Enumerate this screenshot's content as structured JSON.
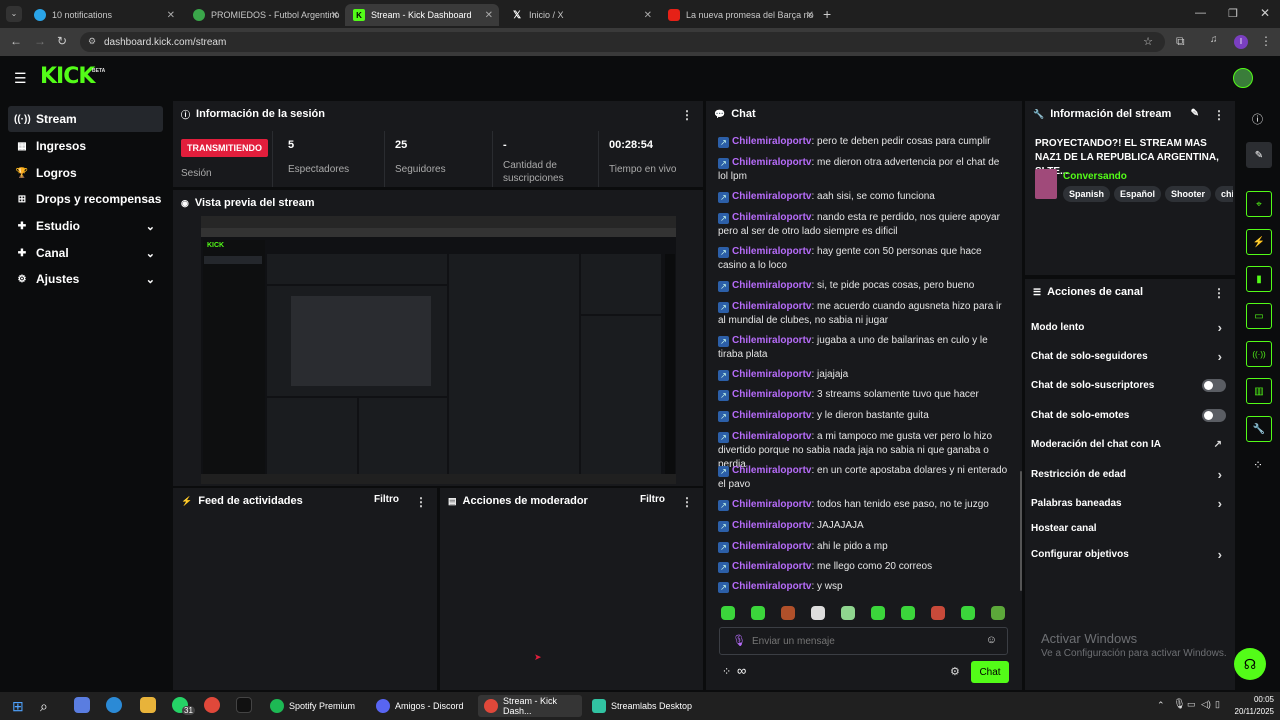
{
  "browser": {
    "tabs": [
      {
        "label": "10 notifications",
        "color": "#2aa4e8"
      },
      {
        "label": "PROMIEDOS - Futbol Argentino",
        "color": "#3aa64a"
      },
      {
        "label": "Stream - Kick Dashboard",
        "color": "#53fc18"
      },
      {
        "label": "Inicio / X",
        "color": "#000000"
      },
      {
        "label": "La nueva promesa del Barça no",
        "color": "#e62117"
      }
    ],
    "url": "dashboard.kick.com/stream",
    "profile_letter": "I"
  },
  "header": {
    "logo": "KICK",
    "beta": "BETA"
  },
  "sidebar": {
    "items": [
      {
        "label": "Stream",
        "icon": "broadcast-icon",
        "glyph": "((·))"
      },
      {
        "label": "Ingresos",
        "icon": "money-icon",
        "glyph": "▦"
      },
      {
        "label": "Logros",
        "icon": "trophy-icon",
        "glyph": "🏆"
      },
      {
        "label": "Drops y recompensas",
        "icon": "gift-icon",
        "glyph": "⊞"
      },
      {
        "label": "Estudio",
        "icon": "studio-icon",
        "glyph": "✚"
      },
      {
        "label": "Canal",
        "icon": "channel-icon",
        "glyph": "✚"
      },
      {
        "label": "Ajustes",
        "icon": "gear-icon",
        "glyph": "⚙"
      }
    ]
  },
  "session": {
    "title": "Información de la sesión",
    "badge": "TRANSMITIENDO",
    "badge_label": "Sesión",
    "stats": [
      {
        "value": "5",
        "label": "Espectadores"
      },
      {
        "value": "25",
        "label": "Seguidores"
      },
      {
        "value": "-",
        "label": "Cantidad de suscripciones"
      },
      {
        "value": "00:28:54",
        "label": "Tiempo en vivo"
      }
    ]
  },
  "preview": {
    "title": "Vista previa del stream"
  },
  "feed": {
    "title": "Feed de actividades",
    "filter": "Filtro"
  },
  "mod": {
    "title": "Acciones de moderador",
    "filter": "Filtro"
  },
  "chat": {
    "title": "Chat",
    "messages": [
      {
        "user": "Chilemiraloportv",
        "text": "pero te deben pedir cosas para cumplir"
      },
      {
        "user": "Chilemiraloportv",
        "text": "me dieron otra advertencia por el chat de lol lpm"
      },
      {
        "user": "Chilemiraloportv",
        "text": "aah sisi, se como funciona"
      },
      {
        "user": "Chilemiraloportv",
        "text": "nando esta re perdido, nos quiere apoyar pero al ser de otro lado siempre es dificil"
      },
      {
        "user": "Chilemiraloportv",
        "text": "hay gente con 50 personas que hace casino a lo loco"
      },
      {
        "user": "Chilemiraloportv",
        "text": "si, te pide pocas cosas, pero bueno"
      },
      {
        "user": "Chilemiraloportv",
        "text": "me acuerdo cuando agusneta hizo para ir al mundial de clubes, no sabia ni jugar"
      },
      {
        "user": "Chilemiraloportv",
        "text": "jugaba a uno de bailarinas en culo y le tiraba plata"
      },
      {
        "user": "Chilemiraloportv",
        "text": "jajajaja"
      },
      {
        "user": "Chilemiraloportv",
        "text": "3 streams solamente tuvo que hacer"
      },
      {
        "user": "Chilemiraloportv",
        "text": "y le dieron bastante guita"
      },
      {
        "user": "Chilemiraloportv",
        "text": "a mi tampoco me gusta ver pero lo hizo divertido porque no sabia nada jaja no sabia ni que ganaba o perdia"
      },
      {
        "user": "Chilemiraloportv",
        "text": "en un corte apostaba dolares y ni enterado el pavo"
      },
      {
        "user": "Chilemiraloportv",
        "text": "todos han tenido ese paso, no te juzgo"
      },
      {
        "user": "Chilemiraloportv",
        "text": "JAJAJAJA"
      },
      {
        "user": "Chilemiraloportv",
        "text": "ahi le pido a mp"
      },
      {
        "user": "Chilemiraloportv",
        "text": "me llego como 20 correos"
      },
      {
        "user": "Chilemiraloportv",
        "text": "y wsp"
      }
    ],
    "input_placeholder": "Enviar un mensaje",
    "send_label": "Chat",
    "infinity": "∞"
  },
  "stream_info": {
    "title": "Información del stream",
    "stream_title": "PROYECTANDO?! EL STREAM MAS NAZ1 DE LA REPUBLICA ARGENTINA, SI TE...",
    "category": "Conversando",
    "tags": [
      "Spanish",
      "Español",
      "Shooter",
      "chill"
    ]
  },
  "channel_actions": {
    "title": "Acciones de canal",
    "items": [
      {
        "label": "Modo lento",
        "type": "chevron"
      },
      {
        "label": "Chat de solo-seguidores",
        "type": "chevron"
      },
      {
        "label": "Chat de solo-suscriptores",
        "type": "toggle"
      },
      {
        "label": "Chat de solo-emotes",
        "type": "toggle"
      },
      {
        "label": "Moderación del chat con IA",
        "type": "link"
      },
      {
        "label": "Restricción de edad",
        "type": "chevron"
      },
      {
        "label": "Palabras baneadas",
        "type": "chevron"
      },
      {
        "label": "Hostear canal",
        "type": "none"
      },
      {
        "label": "Configurar objetivos",
        "type": "chevron"
      }
    ]
  },
  "watermark": {
    "title": "Activar Windows",
    "subtitle": "Ve a Configuración para activar Windows."
  },
  "taskbar": {
    "apps": [
      {
        "label": "Spotify Premium",
        "color": "#1db954"
      },
      {
        "label": "Amigos - Discord",
        "color": "#5865f2"
      },
      {
        "label": "Stream - Kick Dash...",
        "color": "#53fc18"
      },
      {
        "label": "Streamlabs Desktop",
        "color": "#31c3a2"
      }
    ],
    "whatsapp_badge": "31",
    "time": "00:05",
    "date": "20/11/2025"
  }
}
